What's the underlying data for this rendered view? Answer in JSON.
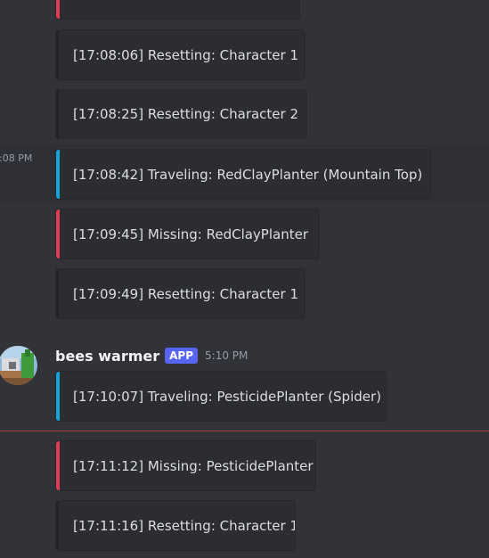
{
  "hover": {
    "time": ":08 PM"
  },
  "author": {
    "name": "bees warmer",
    "badge": "APP",
    "time": "5:10 PM"
  },
  "messages": [
    {
      "text": "",
      "accent": "red"
    },
    {
      "text": "[17:08:06] Resetting: Character 1",
      "accent": "none"
    },
    {
      "text": "[17:08:25] Resetting: Character 2",
      "accent": "none"
    },
    {
      "text": "[17:08:42] Traveling: RedClayPlanter (Mountain Top)",
      "accent": "blue"
    },
    {
      "text": "[17:09:45] Missing: RedClayPlanter",
      "accent": "red"
    },
    {
      "text": "[17:09:49] Resetting: Character 1",
      "accent": "none"
    },
    {
      "text": "[17:10:07] Traveling: PesticidePlanter (Spider)",
      "accent": "blue"
    },
    {
      "text": "[17:11:12] Missing: PesticidePlanter",
      "accent": "red"
    },
    {
      "text": "[17:11:16] Resetting: Character 1",
      "accent": "none"
    }
  ],
  "colors": {
    "background": "#313338",
    "embed": "#2b2d31",
    "accent_red": "#e23a52",
    "accent_blue": "#11a6d8",
    "badge": "#5865f2",
    "new_divider": "#c9363f"
  }
}
